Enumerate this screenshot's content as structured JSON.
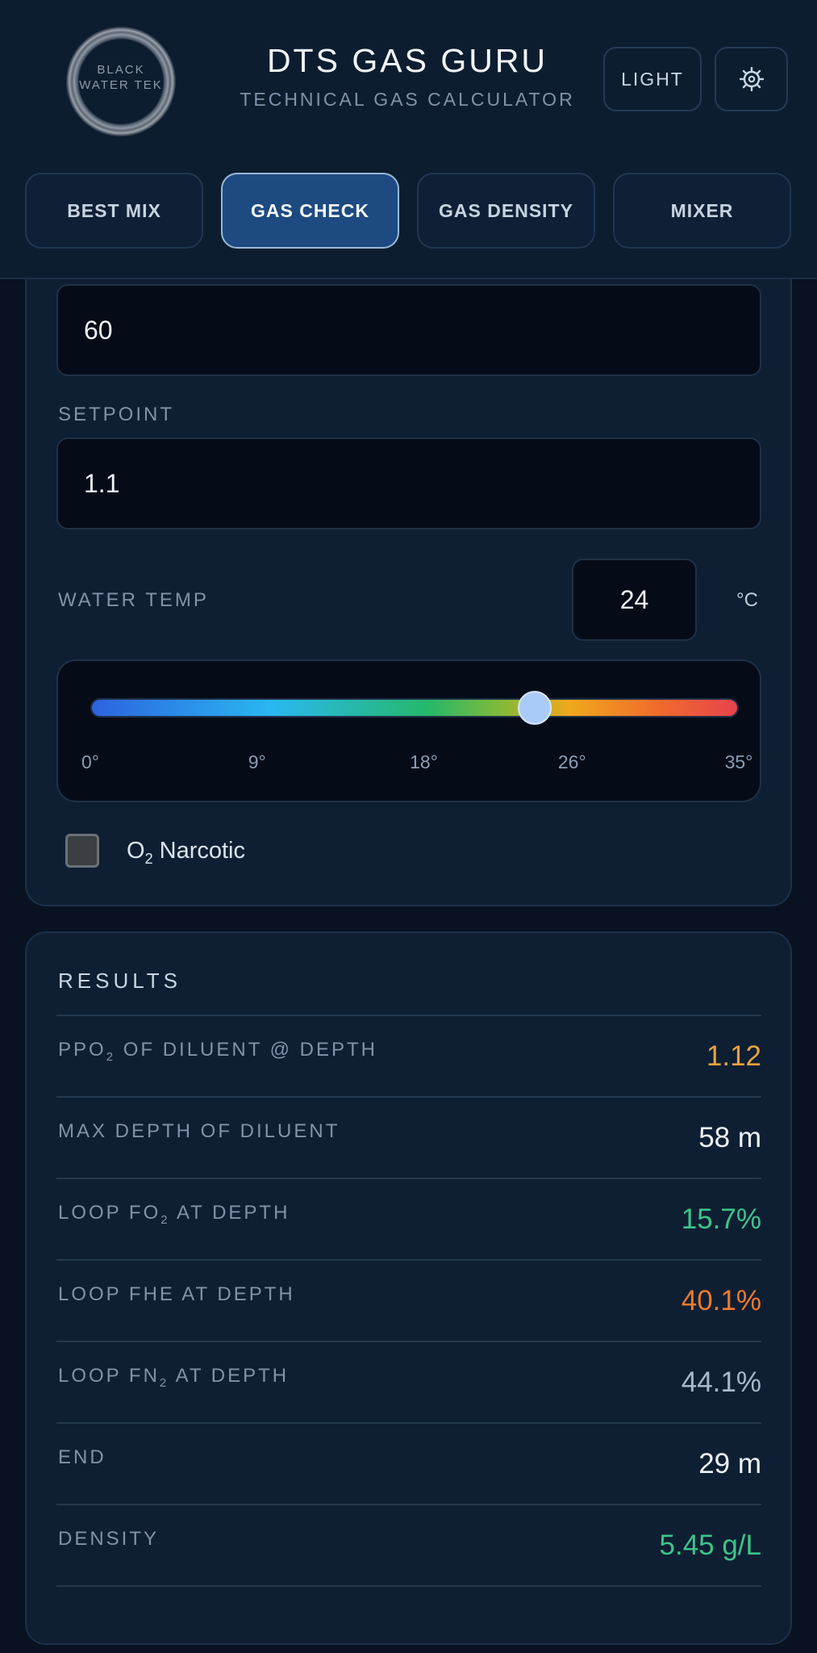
{
  "header": {
    "logo_text": "BLACK\nWATER TEK",
    "title": "DTS GAS GURU",
    "subtitle": "TECHNICAL GAS CALCULATOR",
    "light_button": "LIGHT",
    "settings_icon": "gear-icon"
  },
  "tabs": [
    {
      "label": "BEST MIX",
      "active": false
    },
    {
      "label": "GAS CHECK",
      "active": true
    },
    {
      "label": "GAS DENSITY",
      "active": false
    },
    {
      "label": "MIXER",
      "active": false
    }
  ],
  "form": {
    "depth_value": "60",
    "setpoint_label": "SETPOINT",
    "setpoint_value": "1.1",
    "water_temp_label": "WATER TEMP",
    "water_temp_value": "24",
    "water_temp_unit": "°C",
    "slider": {
      "min": 0,
      "max": 35,
      "value": 24,
      "ticks": [
        "0°",
        "9°",
        "18°",
        "26°",
        "35°"
      ]
    },
    "o2_narcotic_label": "O",
    "o2_narcotic_sub": "2",
    "o2_narcotic_suffix": " Narcotic",
    "o2_narcotic_checked": false
  },
  "results": {
    "title": "RESULTS",
    "rows": [
      {
        "label": "PPO",
        "sub": "2",
        "suffix": " OF DILUENT @ DEPTH",
        "value": "1.12",
        "color": "#e8a33d"
      },
      {
        "label": "MAX DEPTH OF DILUENT",
        "sub": "",
        "suffix": "",
        "value": "58 m",
        "color": "#eef3f8"
      },
      {
        "label": "LOOP FO",
        "sub": "2",
        "suffix": " AT DEPTH",
        "value": "15.7%",
        "color": "#3ec48a"
      },
      {
        "label": "LOOP FHE AT DEPTH",
        "sub": "",
        "suffix": "",
        "value": "40.1%",
        "color": "#ee7a2c"
      },
      {
        "label": "LOOP FN",
        "sub": "2",
        "suffix": " AT DEPTH",
        "value": "44.1%",
        "color": "#aab9c9"
      },
      {
        "label": "END",
        "sub": "",
        "suffix": "",
        "value": "29 m",
        "color": "#eef3f8"
      },
      {
        "label": "DENSITY",
        "sub": "",
        "suffix": "",
        "value": "5.45 g/L",
        "color": "#3ec48a"
      }
    ]
  }
}
